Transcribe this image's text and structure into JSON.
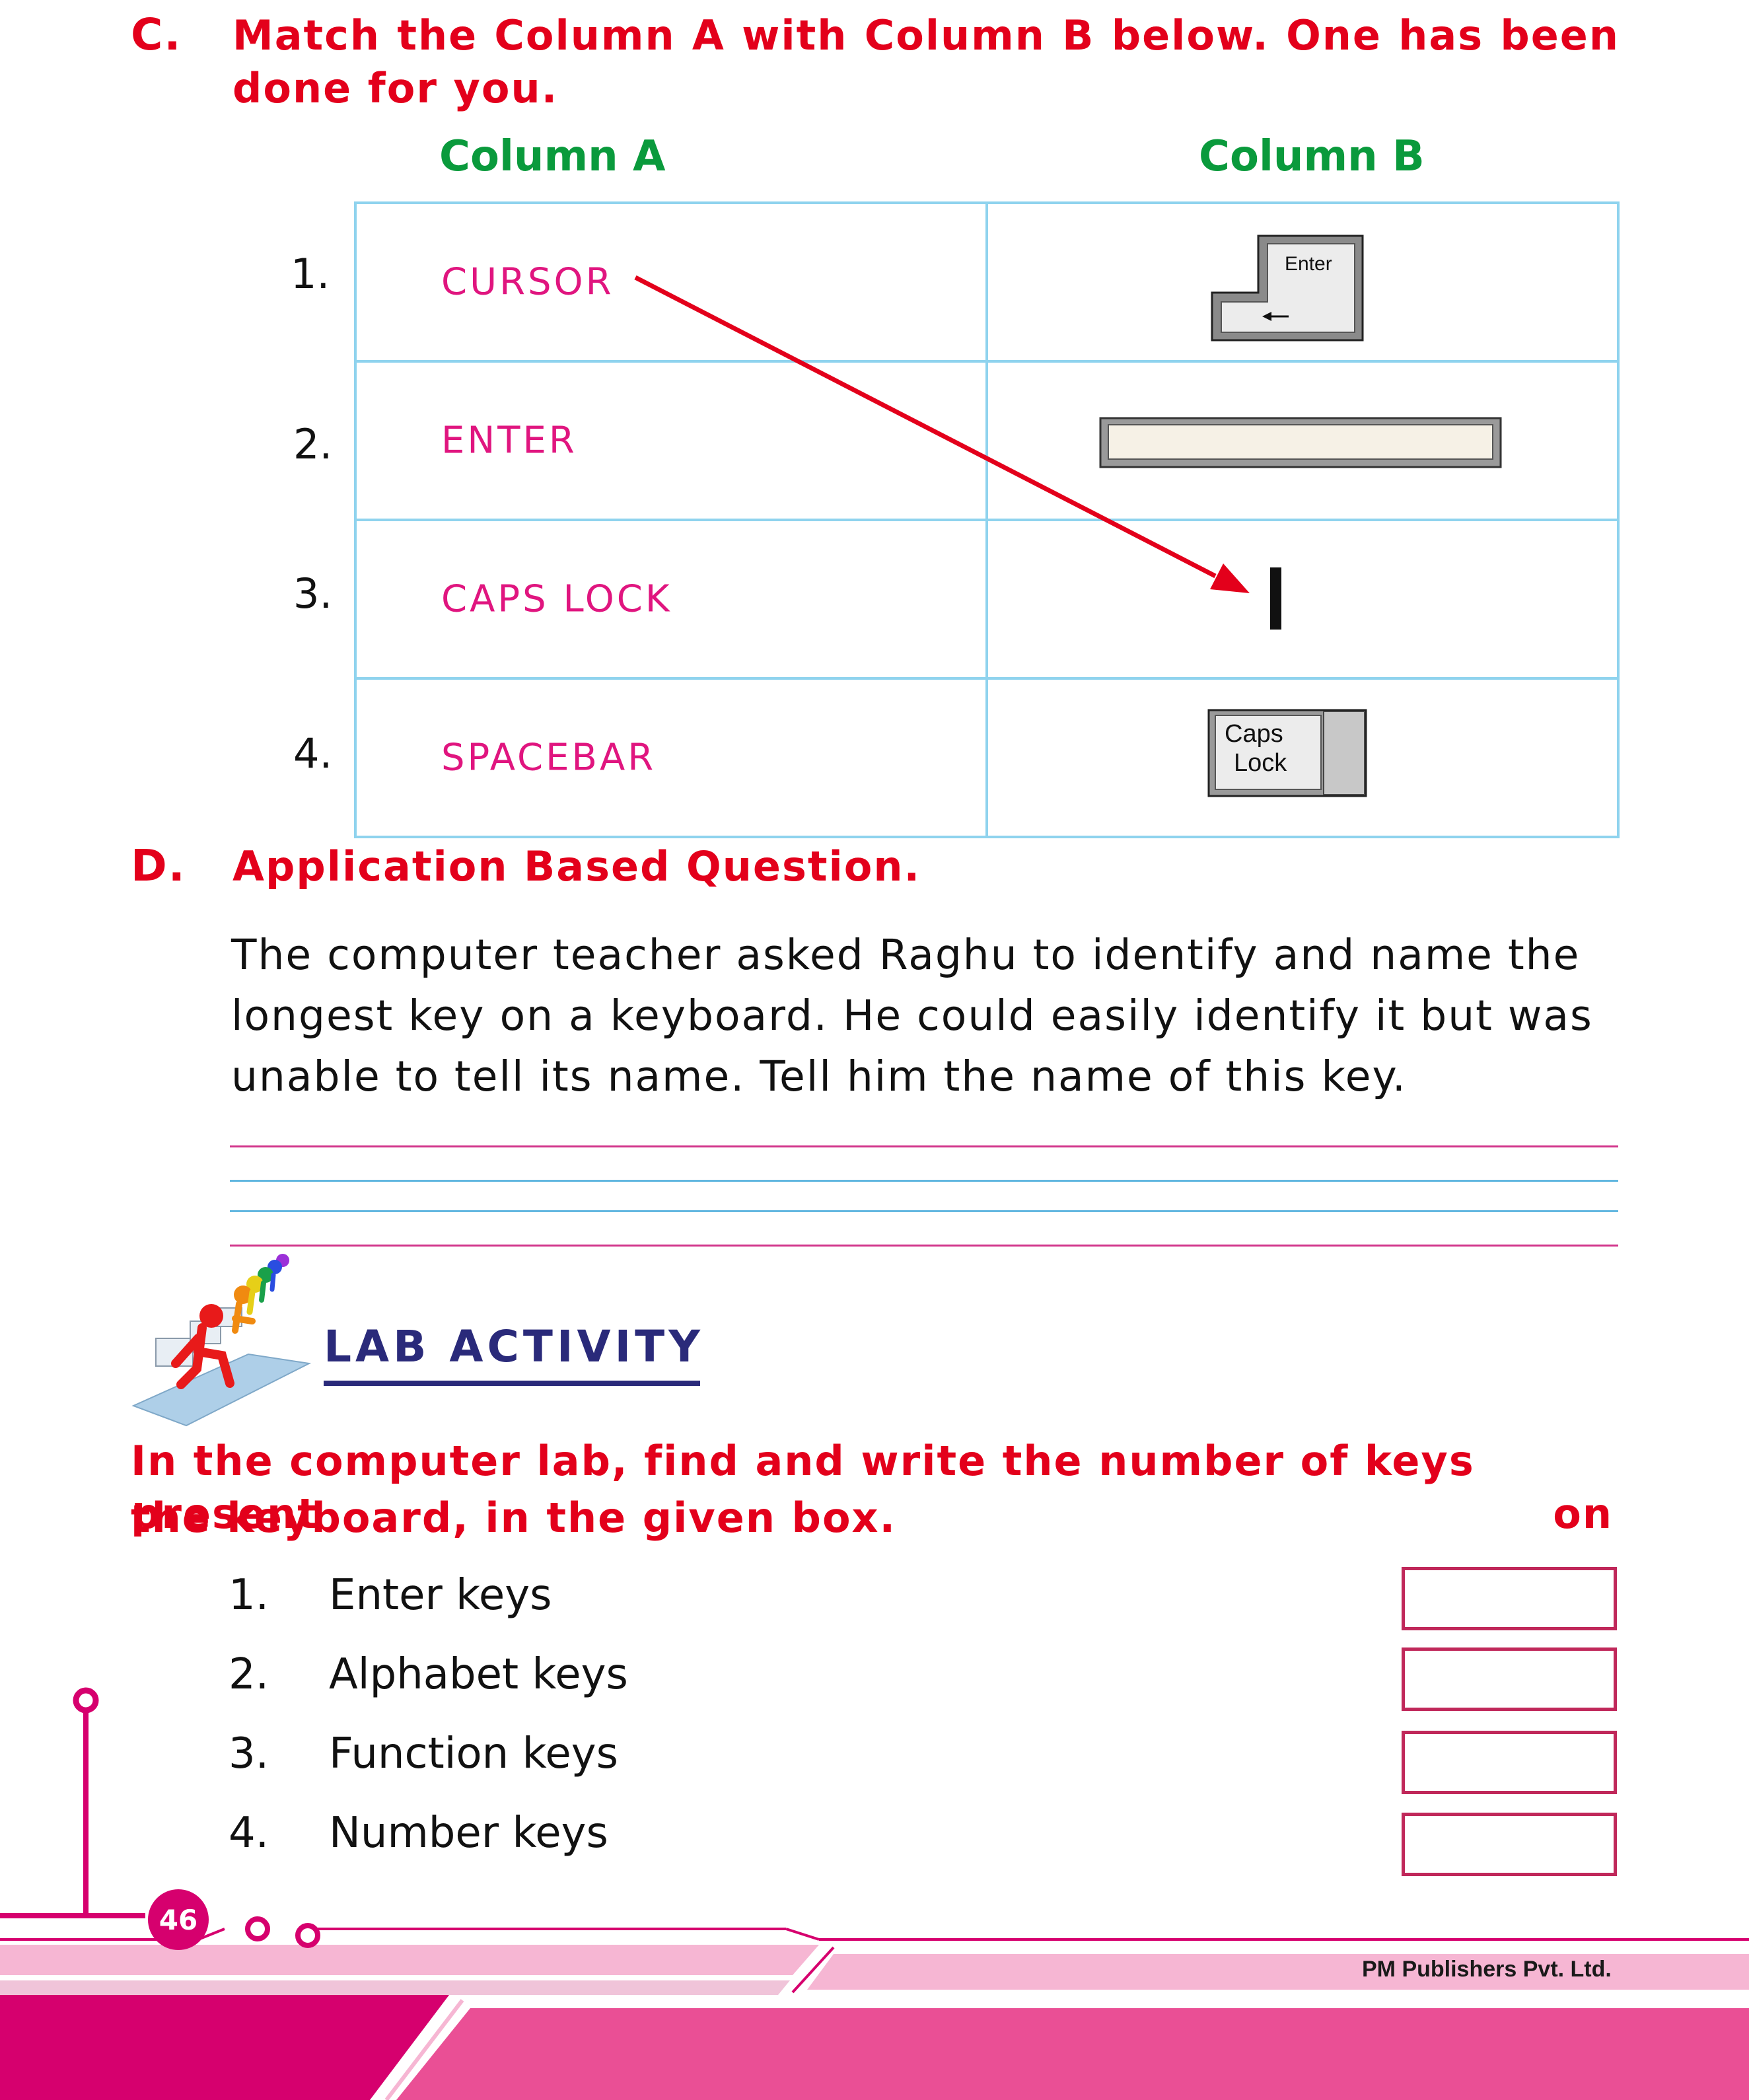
{
  "section_c": {
    "letter": "C.",
    "line1": "Match the Column A with Column B below. One has been",
    "line2": "done for you.",
    "column_a_header": "Column A",
    "column_b_header": "Column B",
    "rows": [
      {
        "number": "1.",
        "term": "CURSOR"
      },
      {
        "number": "2.",
        "term": "ENTER"
      },
      {
        "number": "3.",
        "term": "CAPS LOCK"
      },
      {
        "number": "4.",
        "term": "SPACEBAR"
      }
    ],
    "column_b_images": [
      {
        "icon": "enter-key-icon",
        "label": "Enter"
      },
      {
        "icon": "spacebar-key-icon"
      },
      {
        "icon": "cursor-bar-icon"
      },
      {
        "icon": "caps-lock-key-icon",
        "label_line1": "Caps",
        "label_line2": "Lock"
      }
    ]
  },
  "section_d": {
    "letter": "D.",
    "title": "Application Based Question.",
    "para_line1": "The computer teacher asked Raghu to identify and name the",
    "para_line2": "longest key on a keyboard. He could easily identify it but was",
    "para_line3": "unable to tell its name. Tell him the name of this key."
  },
  "lab": {
    "title": "LAB ACTIVITY",
    "instruction_line1": "In the computer lab, find and write the number of keys present on",
    "instruction_line2": "the keyboard, in the given box.",
    "items": [
      {
        "number": "1.",
        "text": "Enter keys"
      },
      {
        "number": "2.",
        "text": "Alphabet keys"
      },
      {
        "number": "3.",
        "text": "Function keys"
      },
      {
        "number": "4.",
        "text": "Number keys"
      }
    ]
  },
  "footer": {
    "page_number": "46",
    "publisher": "PM Publishers Pvt. Ltd."
  },
  "colors": {
    "heading_red": "#e3001b",
    "column_green": "#0a9a3c",
    "term_pink": "#e0157f",
    "table_border": "#8fd3ee",
    "lab_title_navy": "#2a2a7a",
    "footer_magenta": "#d6006e",
    "footer_pink": "#ea4f95",
    "footer_light_pink": "#f6b6d3"
  }
}
